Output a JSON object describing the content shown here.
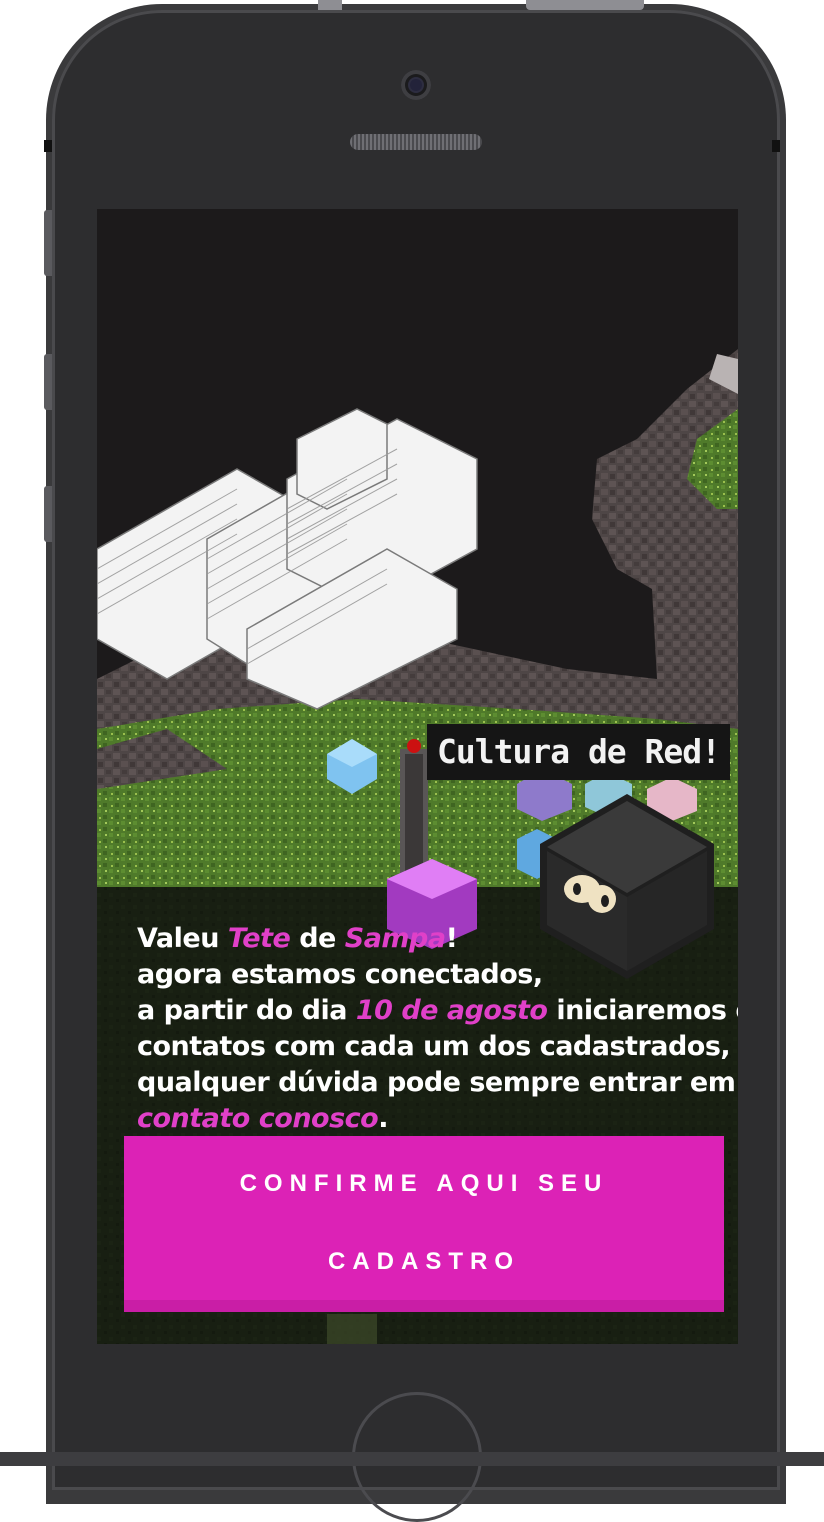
{
  "game": {
    "label": "Cultura de Red!"
  },
  "message": {
    "l1_a": "Valeu ",
    "l1_name": "Tete",
    "l1_b": " de ",
    "l1_city": "Sampa",
    "l1_c": "!",
    "l2": "agora estamos conectados,",
    "l3_a": "a partir do dia ",
    "l3_date": "10 de agosto",
    "l3_b": " iniciaremos os",
    "l4": "contatos com cada um dos cadastrados,",
    "l5": "qualquer dúvida pode sempre entrar em",
    "l6_link": "contato conosco",
    "l6_b": "."
  },
  "cta": {
    "line1": "CONFIRME AQUI SEU",
    "line2": "CADASTRO"
  },
  "colors": {
    "accent": "#dc22b6",
    "highlight": "#e040c8",
    "phone_body": "#2d2d2f"
  }
}
